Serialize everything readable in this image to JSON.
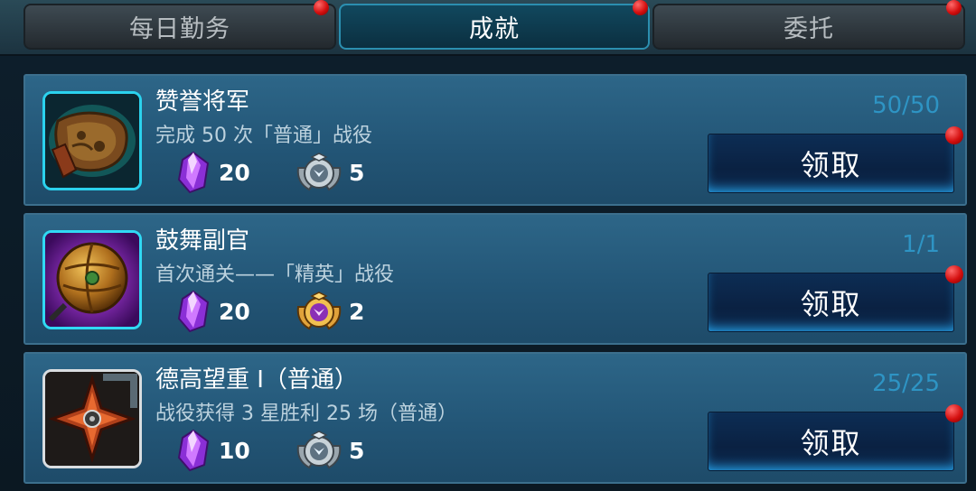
{
  "tabs": [
    {
      "label": "每日勤务",
      "active": false
    },
    {
      "label": "成就",
      "active": true
    },
    {
      "label": "委托",
      "active": false
    }
  ],
  "achievements": [
    {
      "title": "赞誉将军",
      "desc": "完成 50 次「普通」战役",
      "progress": "50/50",
      "icon": "scroll-map-icon",
      "rewards": [
        {
          "icon": "purple-crystal-icon",
          "qty": "20"
        },
        {
          "icon": "silver-medal-icon",
          "qty": "5"
        }
      ],
      "claim_label": "领取"
    },
    {
      "title": "鼓舞副官",
      "desc": "首次通关——「精英」战役",
      "progress": "1/1",
      "icon": "golden-orb-icon",
      "rewards": [
        {
          "icon": "purple-crystal-icon",
          "qty": "20"
        },
        {
          "icon": "gold-medal-icon",
          "qty": "2"
        }
      ],
      "claim_label": "领取"
    },
    {
      "title": "德高望重 I（普通）",
      "desc": "战役获得 3 星胜利 25 场（普通）",
      "progress": "25/25",
      "icon": "shuriken-icon",
      "rewards": [
        {
          "icon": "purple-crystal-icon",
          "qty": "10"
        },
        {
          "icon": "silver-medal-icon",
          "qty": "5"
        }
      ],
      "claim_label": "领取"
    }
  ],
  "colors": {
    "progress": "#2e94c4",
    "active_tab_border": "#2b8fb0",
    "notification_dot": "#d40f0f"
  }
}
